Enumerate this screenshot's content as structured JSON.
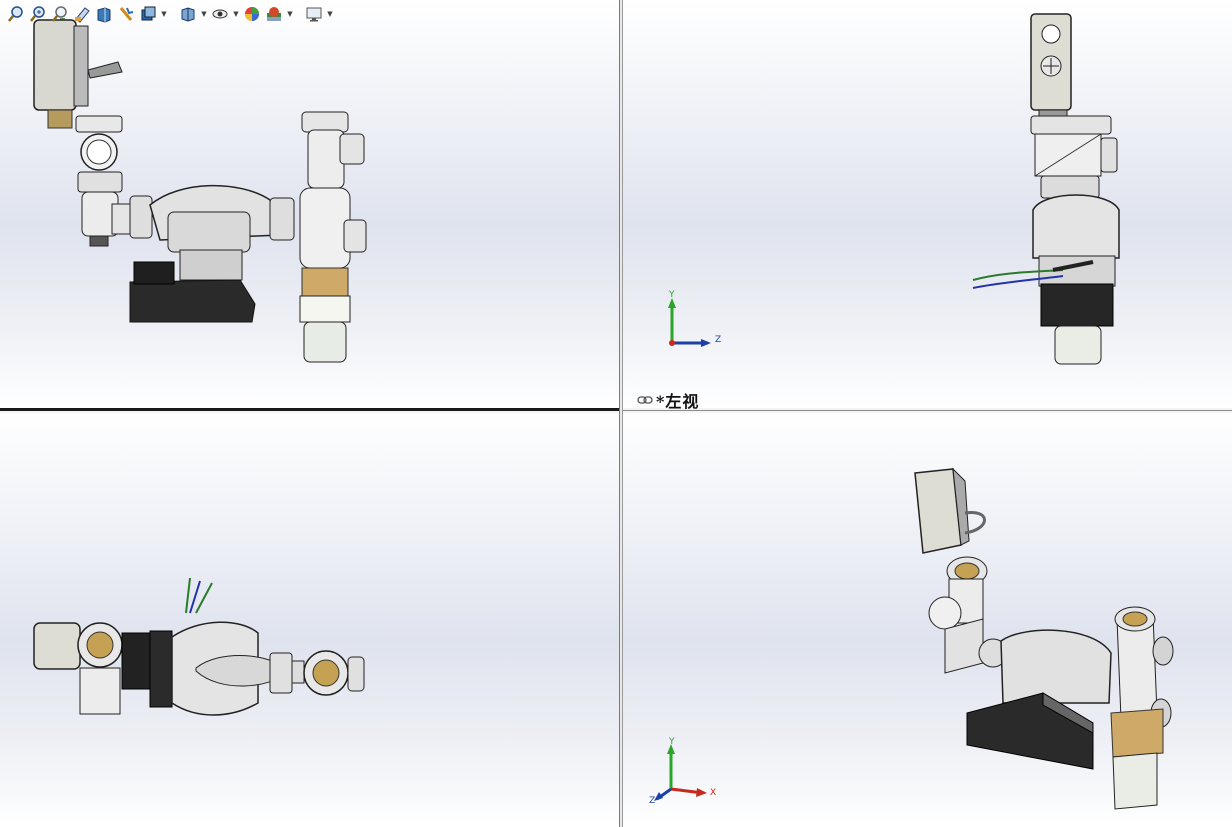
{
  "toolbar": {
    "items": [
      {
        "name": "zoom-to-fit-icon"
      },
      {
        "name": "zoom-to-area-icon"
      },
      {
        "name": "previous-view-icon"
      },
      {
        "name": "section-view-icon"
      },
      {
        "name": "dynamic-annotation-icon"
      },
      {
        "name": "view-orientation-icon"
      },
      {
        "name": "display-style-icon"
      },
      {
        "name": "hide-show-items-icon"
      },
      {
        "name": "edit-appearance-icon"
      },
      {
        "name": "apply-scene-icon"
      },
      {
        "name": "view-settings-icon"
      }
    ]
  },
  "viewports": {
    "top_right": {
      "label": "*左视"
    }
  },
  "triads": {
    "right": {
      "y": "Y",
      "z": "Z"
    },
    "iso": {
      "y": "Y",
      "z": "Z",
      "x": "X"
    }
  },
  "colors": {
    "accent_y": "#2aa52a",
    "accent_z": "#1d3fa8",
    "accent_x": "#c8281e",
    "divider": "#1a1a1a"
  }
}
